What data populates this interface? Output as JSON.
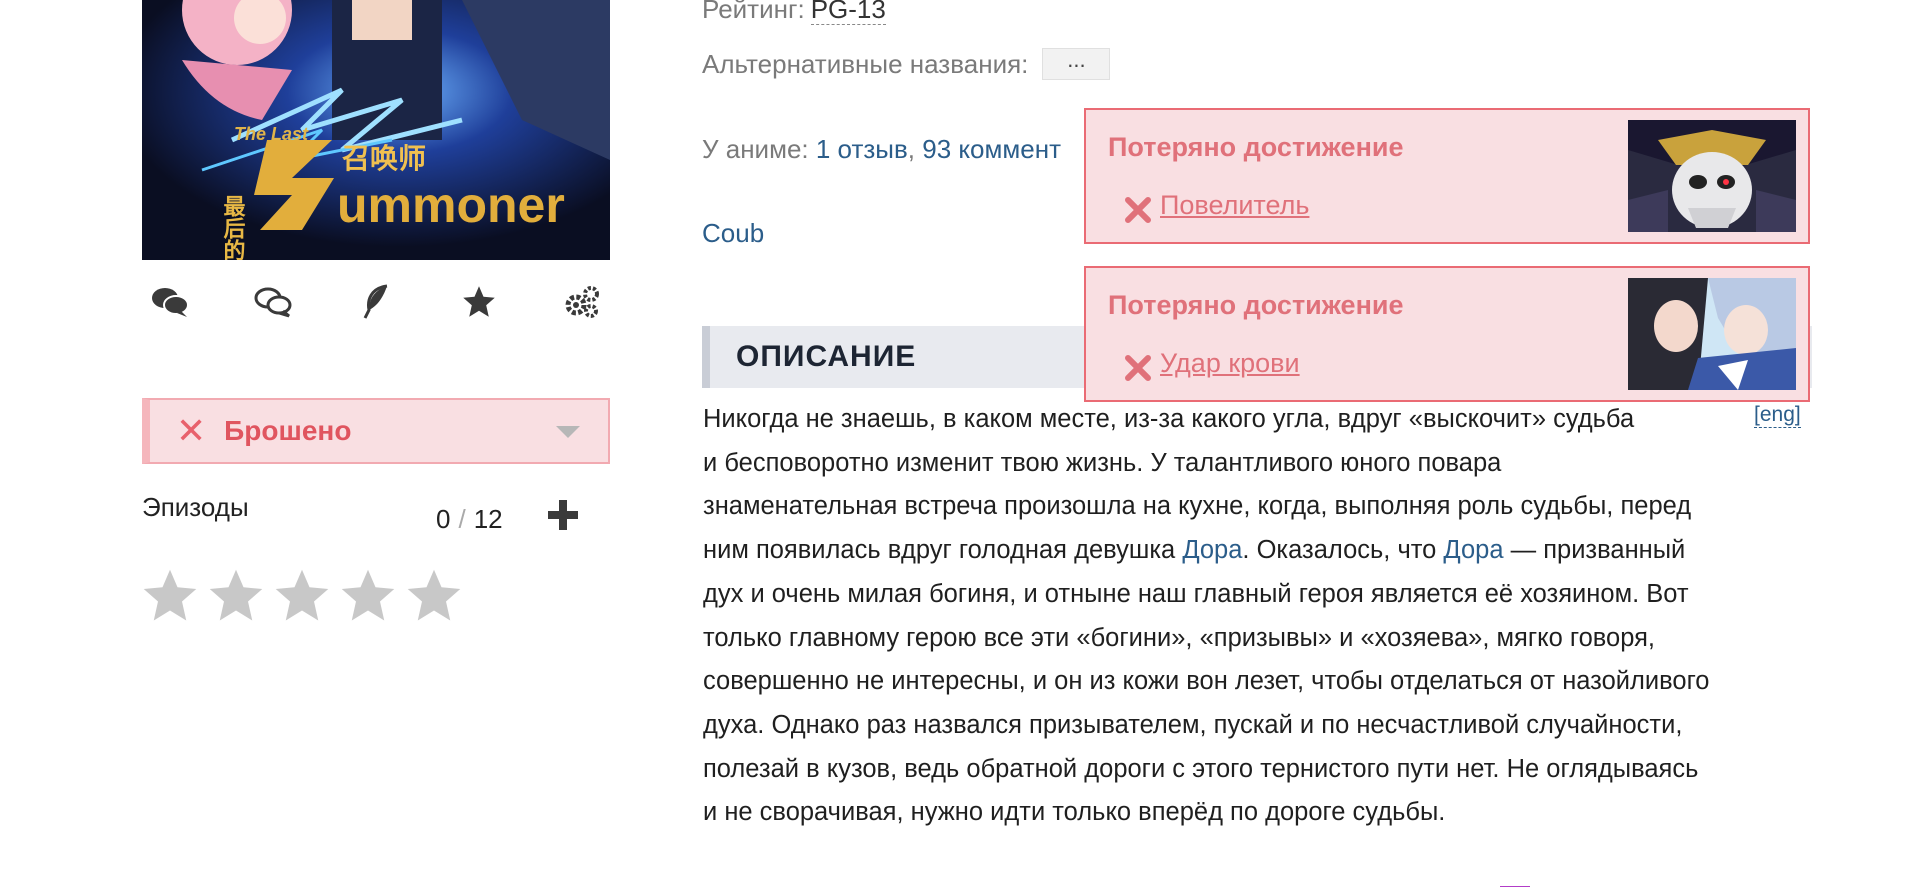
{
  "poster": {
    "logo_small": "The Last",
    "logo_cn_left": "最后的",
    "logo_cn_right": "召唤师",
    "logo_main": "ummoner"
  },
  "status": {
    "label": "Брошено"
  },
  "episodes": {
    "label": "Эпизоды",
    "watched": "0",
    "separator": "/",
    "total": "12"
  },
  "stars": {
    "count": 5,
    "rating": 0
  },
  "meta": {
    "rating_label": "Рейтинг:",
    "rating_value": "PG-13",
    "alt_names_label": "Альтернативные названия:",
    "alt_names_button": "...",
    "anime_label": "У аниме:",
    "reviews_link": "1 отзыв",
    "comma": ",",
    "comments_link": "93 коммент",
    "coub_link": "Coub"
  },
  "description": {
    "heading": "ОПИСАНИЕ",
    "eng_link": "[eng]",
    "lines": [
      "Никогда не знаешь, в каком месте, из-за какого угла, вдруг «выскочит» судьба",
      "и бесповоротно изменит твою жизнь. У талантливого юного повара",
      "знаменательная встреча произошла на кухне, когда, выполняя роль судьбы, перед",
      [
        "ним появилась вдруг голодная девушка ",
        "Дора",
        ". Оказалось, что ",
        "Дора",
        " — призванный"
      ],
      "дух и очень милая богиня, и отныне наш главный героя является её хозяином. Вот",
      "только главному герою все эти «богини», «призывы» и «хозяева», мягко говоря,",
      "совершенно не интересны, и он из кожи вон лезет, чтобы отделаться от назойливого",
      "духа. Однако раз назвался призывателем, пускай и по несчастливой случайности,",
      "полезай в кузов, ведь обратной дороги с этого тернистого пути нет. Не оглядываясь",
      "и не сворачивая, нужно идти только вперёд по дороге судьбы."
    ]
  },
  "achievements": [
    {
      "title": "Потеряно достижение",
      "name": "Повелитель"
    },
    {
      "title": "Потеряно достижение",
      "name": "Удар крови"
    }
  ],
  "colors": {
    "link": "#2b5d8a",
    "dropped_red": "#e0555f",
    "achievement_pink": "#f9dfe2",
    "achievement_border": "#ea6b74",
    "icon_dark": "#3a3a3a",
    "star_gray": "#c8c8c8"
  },
  "icons": [
    "comments-filled-icon",
    "comments-outline-icon",
    "feather-icon",
    "star-icon",
    "gears-icon",
    "plus-icon",
    "close-x-icon",
    "caret-down-icon"
  ]
}
